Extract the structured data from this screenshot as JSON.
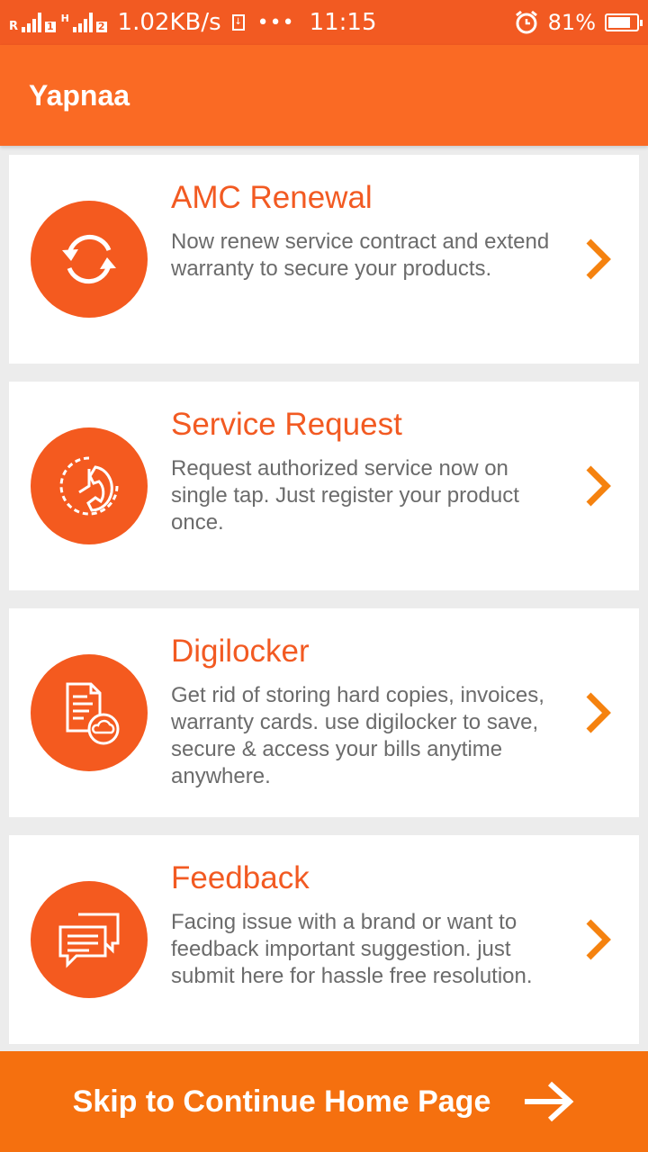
{
  "status": {
    "net_speed": "1.02KB/s",
    "time": "11:15",
    "battery_pct": "81%",
    "battery_level": 0.81,
    "sim1_tag": "R",
    "sim1_no": "1",
    "sim2_tag": "H",
    "sim2_no": "2",
    "download_glyph": "↓",
    "dots": "•••"
  },
  "app": {
    "title": "Yapnaa"
  },
  "cards": [
    {
      "title": "AMC Renewal",
      "desc": "Now renew service contract and extend warranty to secure your products.",
      "icon": "refresh-icon"
    },
    {
      "title": "Service Request",
      "desc": "Request authorized service now on single tap. Just register your product once.",
      "icon": "clock-phone-icon"
    },
    {
      "title": "Digilocker",
      "desc": "Get rid of storing hard copies, invoices, warranty cards. use digilocker to save, secure & access your bills anytime anywhere.",
      "icon": "document-cloud-icon"
    },
    {
      "title": "Feedback",
      "desc": "Facing issue with a brand or want to feedback important suggestion. just submit here for hassle free resolution.",
      "icon": "chat-bubbles-icon"
    }
  ],
  "footer": {
    "skip_label": "Skip to Continue Home Page",
    "icon": "arrow-right-icon"
  },
  "colors": {
    "status_bar": "#f25a22",
    "app_bar": "#fa6a24",
    "accent": "#f45a1f",
    "footer": "#f5700f"
  }
}
